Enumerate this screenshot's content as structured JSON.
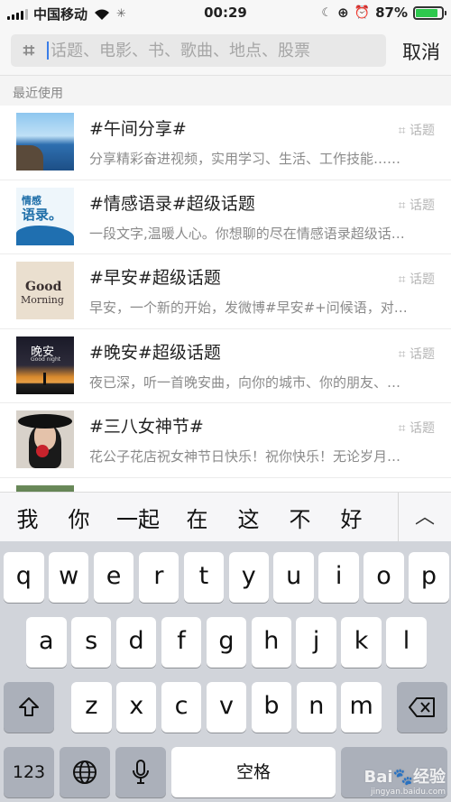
{
  "status_bar": {
    "carrier": "中国移动",
    "time": "00:29",
    "battery_percent": "87%",
    "battery_level": 0.87,
    "battery_color": "#2dc84d"
  },
  "search": {
    "placeholder": "话题、电影、书、歌曲、地点、股票",
    "cancel_label": "取消"
  },
  "section_title": "最近使用",
  "topics": [
    {
      "title": "#午间分享#",
      "desc": "分享精彩奋进视频，实用学习、生活、工作技能……",
      "tag": "话题"
    },
    {
      "title": "#情感语录#超级话题",
      "desc": "一段文字,温暖人心。你想聊的尽在情感语录超级话…",
      "tag": "话题",
      "thumb_line1": "情感",
      "thumb_line2": "语录。"
    },
    {
      "title": "#早安#超级话题",
      "desc": "早安，一个新的开始，发微博#早安#+问候语，对…",
      "tag": "话题",
      "thumb_line1": "Good",
      "thumb_line2": "Morning"
    },
    {
      "title": "#晚安#超级话题",
      "desc": "夜已深，听一首晚安曲，向你的城市、你的朋友、…",
      "tag": "话题",
      "thumb_line1": "晚安",
      "thumb_line2": "Good night"
    },
    {
      "title": "#三八女神节#",
      "desc": "花公子花店祝女神节日快乐！祝你快乐！无论岁月…",
      "tag": "话题"
    }
  ],
  "candidates": [
    "我",
    "你",
    "一起",
    "在",
    "这",
    "不",
    "好"
  ],
  "keyboard": {
    "row1": [
      "q",
      "w",
      "e",
      "r",
      "t",
      "y",
      "u",
      "i",
      "o",
      "p"
    ],
    "row2": [
      "a",
      "s",
      "d",
      "f",
      "g",
      "h",
      "j",
      "k",
      "l"
    ],
    "row3": [
      "z",
      "x",
      "c",
      "v",
      "b",
      "n",
      "m"
    ],
    "numbers_label": "123",
    "space_label": "空格"
  },
  "watermark": {
    "text": "Bai🐾经验",
    "sub": "jingyan.baidu.com"
  }
}
